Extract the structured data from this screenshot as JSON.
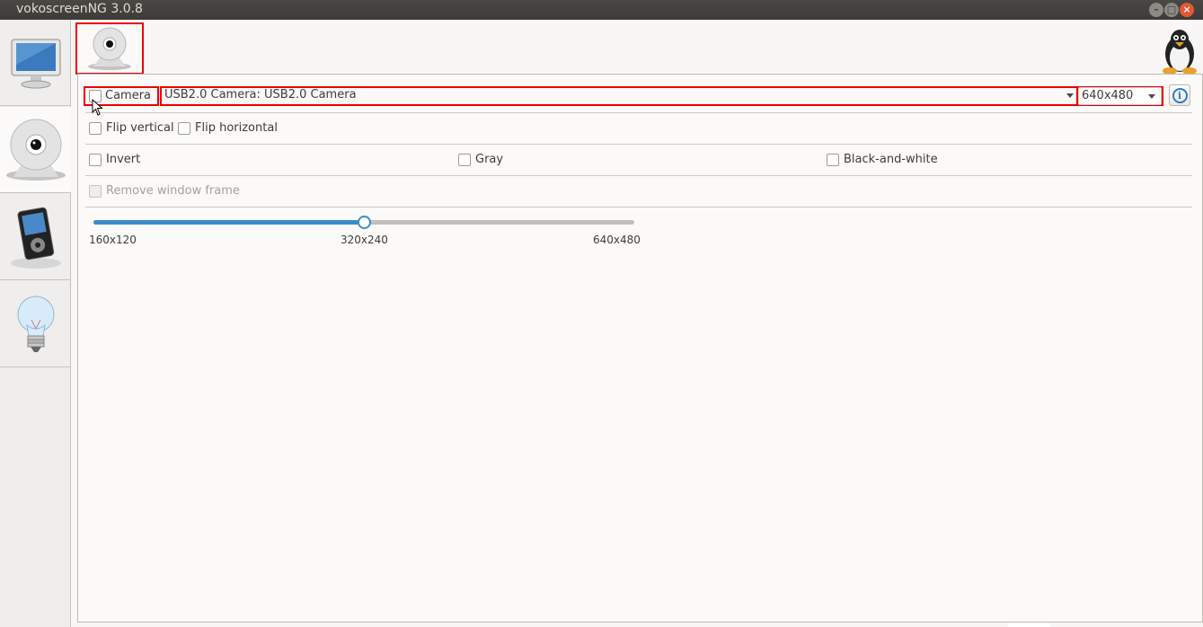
{
  "window": {
    "title": "vokoscreenNG 3.0.8"
  },
  "sidebar": {
    "items": [
      {
        "icon": "monitor-icon",
        "active": false
      },
      {
        "icon": "webcam-icon",
        "active": true
      },
      {
        "icon": "media-player-icon",
        "active": false
      },
      {
        "icon": "lightbulb-icon",
        "active": false
      }
    ]
  },
  "camera_panel": {
    "tab_icon": "webcam-icon",
    "camera_checkbox_label": "Camera",
    "camera_checked": false,
    "camera_device": "USB2.0 Camera: USB2.0 Camera",
    "resolution": "640x480",
    "flip_vertical_label": "Flip vertical",
    "flip_horizontal_label": "Flip horizontal",
    "invert_label": "Invert",
    "gray_label": "Gray",
    "black_white_label": "Black-and-white",
    "remove_frame_label": "Remove window frame",
    "size_slider": {
      "ticks": [
        "160x120",
        "320x240",
        "640x480"
      ],
      "value_index": 1
    }
  },
  "colors": {
    "highlight": "#e00000",
    "accent": "#3b8ccb"
  }
}
